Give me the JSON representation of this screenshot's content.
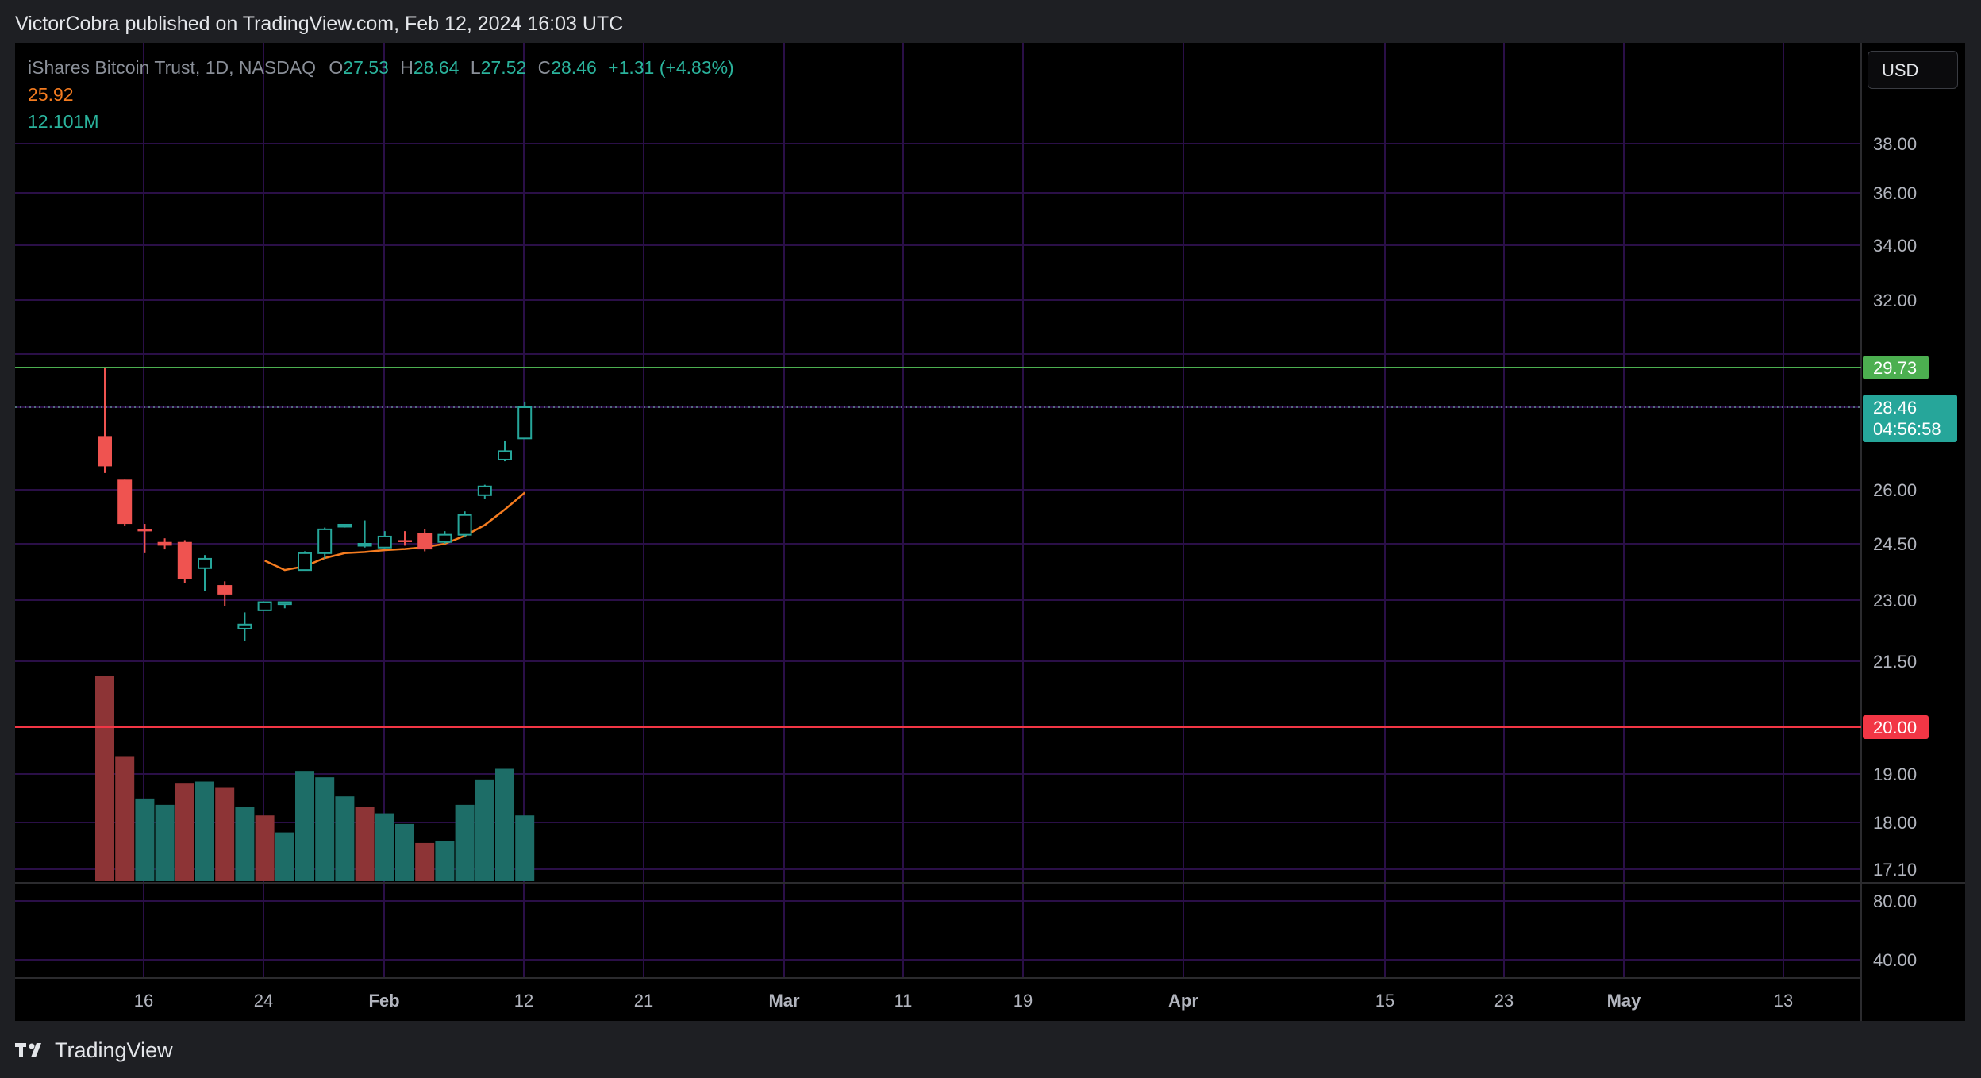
{
  "header": {
    "text": "VictorCobra published on TradingView.com, Feb 12, 2024 16:03 UTC"
  },
  "footer": {
    "brand": "TradingView"
  },
  "currency": {
    "label": "USD"
  },
  "legend": {
    "symbol": "iShares Bitcoin Trust, 1D, NASDAQ",
    "o_label": "O",
    "o_value": "27.53",
    "h_label": "H",
    "h_value": "28.64",
    "l_label": "L",
    "l_value": "27.52",
    "c_label": "C",
    "c_value": "28.46",
    "change": "+1.31 (+4.83%)",
    "ema_value": "25.92",
    "volume_value": "12.101M"
  },
  "colors": {
    "up": "#26a69a",
    "down": "#ef5350",
    "ema": "#f57c20",
    "resistance": "#4caf50",
    "support": "#f23645",
    "grid": "#2a0f47"
  },
  "chart_data": {
    "type": "candlestick",
    "price_axis_ticks": [
      "38.00",
      "36.00",
      "34.00",
      "32.00",
      "26.00",
      "24.50",
      "23.00",
      "21.50",
      "19.00",
      "18.00",
      "17.10"
    ],
    "volume_axis_ticks": [
      "80.00",
      "40.00"
    ],
    "x_ticks": [
      "16",
      "24",
      "Feb",
      "12",
      "21",
      "Mar",
      "11",
      "19",
      "Apr",
      "15",
      "23",
      "May",
      "13"
    ],
    "candles": [
      {
        "o": 27.6,
        "h": 29.72,
        "l": 26.5,
        "c": 26.7
      },
      {
        "o": 26.3,
        "h": 26.3,
        "l": 25.0,
        "c": 25.05
      },
      {
        "o": 24.9,
        "h": 25.05,
        "l": 24.25,
        "c": 24.85
      },
      {
        "o": 24.55,
        "h": 24.65,
        "l": 24.35,
        "c": 24.45
      },
      {
        "o": 24.55,
        "h": 24.6,
        "l": 23.45,
        "c": 23.55
      },
      {
        "o": 23.85,
        "h": 24.2,
        "l": 23.25,
        "c": 24.1
      },
      {
        "o": 23.4,
        "h": 23.5,
        "l": 22.85,
        "c": 23.15
      },
      {
        "o": 22.3,
        "h": 22.7,
        "l": 22.0,
        "c": 22.4
      },
      {
        "o": 22.75,
        "h": 22.95,
        "l": 22.75,
        "c": 22.95
      },
      {
        "o": 22.9,
        "h": 22.95,
        "l": 22.8,
        "c": 22.95
      },
      {
        "o": 23.8,
        "h": 24.3,
        "l": 23.8,
        "c": 24.25
      },
      {
        "o": 24.25,
        "h": 24.95,
        "l": 24.1,
        "c": 24.9
      },
      {
        "o": 24.98,
        "h": 25.05,
        "l": 24.95,
        "c": 25.03
      },
      {
        "o": 24.48,
        "h": 25.15,
        "l": 24.4,
        "c": 24.5
      },
      {
        "o": 24.4,
        "h": 24.85,
        "l": 24.38,
        "c": 24.7
      },
      {
        "o": 24.6,
        "h": 24.85,
        "l": 24.45,
        "c": 24.55
      },
      {
        "o": 24.8,
        "h": 24.9,
        "l": 24.3,
        "c": 24.35
      },
      {
        "o": 24.55,
        "h": 24.85,
        "l": 24.5,
        "c": 24.75
      },
      {
        "o": 24.75,
        "h": 25.4,
        "l": 24.7,
        "c": 25.3
      },
      {
        "o": 25.85,
        "h": 26.15,
        "l": 25.75,
        "c": 26.1
      },
      {
        "o": 26.9,
        "h": 27.45,
        "l": 26.85,
        "c": 27.15
      },
      {
        "o": 27.53,
        "h": 28.64,
        "l": 27.52,
        "c": 28.46
      }
    ],
    "volumes": [
      {
        "value": 97,
        "dir": "down"
      },
      {
        "value": 59,
        "dir": "down"
      },
      {
        "value": 39,
        "dir": "up"
      },
      {
        "value": 36,
        "dir": "up"
      },
      {
        "value": 46,
        "dir": "down"
      },
      {
        "value": 47,
        "dir": "up"
      },
      {
        "value": 44,
        "dir": "down"
      },
      {
        "value": 35,
        "dir": "up"
      },
      {
        "value": 31,
        "dir": "down"
      },
      {
        "value": 23,
        "dir": "up"
      },
      {
        "value": 52,
        "dir": "up"
      },
      {
        "value": 49,
        "dir": "up"
      },
      {
        "value": 40,
        "dir": "up"
      },
      {
        "value": 35,
        "dir": "down"
      },
      {
        "value": 32,
        "dir": "up"
      },
      {
        "value": 27,
        "dir": "up"
      },
      {
        "value": 18,
        "dir": "down"
      },
      {
        "value": 19,
        "dir": "up"
      },
      {
        "value": 36,
        "dir": "up"
      },
      {
        "value": 48,
        "dir": "up"
      },
      {
        "value": 53,
        "dir": "up"
      },
      {
        "value": 31,
        "dir": "up"
      }
    ],
    "ema": [
      null,
      null,
      null,
      null,
      null,
      null,
      null,
      null,
      24.05,
      23.8,
      23.9,
      24.12,
      24.25,
      24.28,
      24.33,
      24.36,
      24.41,
      24.5,
      24.72,
      25.02,
      25.45,
      25.92
    ],
    "last_price_label": "28.46",
    "countdown_label": "04:56:58",
    "resistance": {
      "value": 29.73,
      "label": "29.73"
    },
    "support": {
      "value": 20.0,
      "label": "20.00"
    }
  }
}
